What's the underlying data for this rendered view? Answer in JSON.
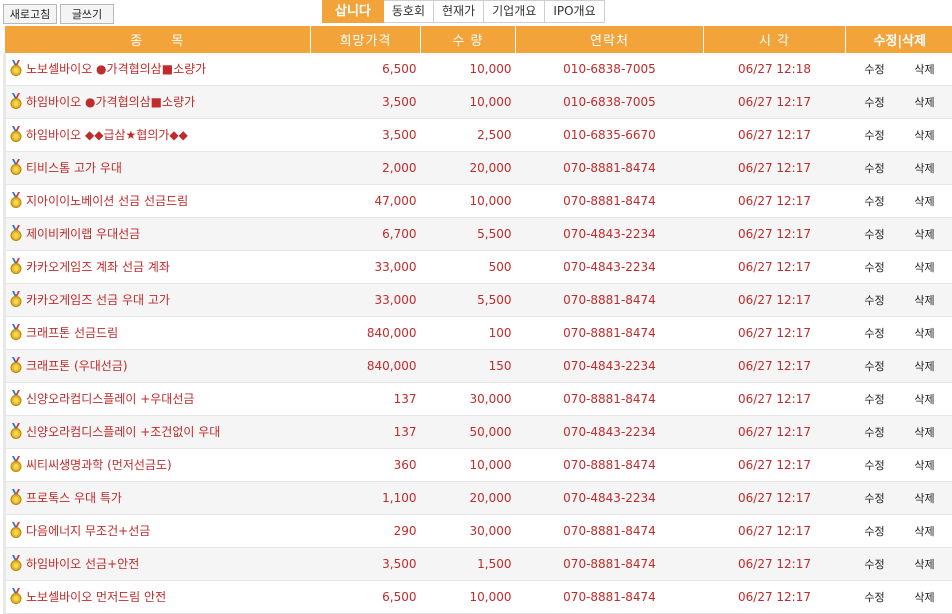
{
  "toolbar": {
    "refresh_label": "새로고침",
    "write_label": "글쓰기"
  },
  "tabs": [
    {
      "label": "삽니다",
      "active": true
    },
    {
      "label": "동호회",
      "active": false
    },
    {
      "label": "현재가",
      "active": false
    },
    {
      "label": "기업개요",
      "active": false
    },
    {
      "label": "IPO개요",
      "active": false
    }
  ],
  "table": {
    "headers": {
      "item": "종　　목",
      "price": "희망가격",
      "qty": "수 량",
      "contact": "연락처",
      "time": "시 각",
      "actions": "수정|삭제"
    },
    "edit_label": "수정",
    "delete_label": "삭제",
    "rows": [
      {
        "name": "노보셀바이오 ●가격협의삼■소량가",
        "price": "6,500",
        "qty": "10,000",
        "contact": "010-6838-7005",
        "time": "06/27 12:18"
      },
      {
        "name": "하임바이오 ●가격협의삼■소량가",
        "price": "3,500",
        "qty": "10,000",
        "contact": "010-6838-7005",
        "time": "06/27 12:17"
      },
      {
        "name": "하임바이오 ◆◆급삼★협의가◆◆",
        "price": "3,500",
        "qty": "2,500",
        "contact": "010-6835-6670",
        "time": "06/27 12:17"
      },
      {
        "name": "티비스톰 고가 우대",
        "price": "2,000",
        "qty": "20,000",
        "contact": "070-8881-8474",
        "time": "06/27 12:17"
      },
      {
        "name": "지아이이노베이션 선금 선금드림",
        "price": "47,000",
        "qty": "10,000",
        "contact": "070-8881-8474",
        "time": "06/27 12:17"
      },
      {
        "name": "제이비케이랩 우대선금",
        "price": "6,700",
        "qty": "5,500",
        "contact": "070-4843-2234",
        "time": "06/27 12:17"
      },
      {
        "name": "카카오게임즈 계좌 선금 계좌",
        "price": "33,000",
        "qty": "500",
        "contact": "070-4843-2234",
        "time": "06/27 12:17"
      },
      {
        "name": "카카오게임즈 선금 우대 고가",
        "price": "33,000",
        "qty": "5,500",
        "contact": "070-8881-8474",
        "time": "06/27 12:17"
      },
      {
        "name": "크래프톤 선금드림",
        "price": "840,000",
        "qty": "100",
        "contact": "070-8881-8474",
        "time": "06/27 12:17"
      },
      {
        "name": "크래프톤 (우대선금)",
        "price": "840,000",
        "qty": "150",
        "contact": "070-4843-2234",
        "time": "06/27 12:17"
      },
      {
        "name": "신양오라컴디스플레이 +우대선금",
        "price": "137",
        "qty": "30,000",
        "contact": "070-8881-8474",
        "time": "06/27 12:17"
      },
      {
        "name": "신양오라컴디스플레이 +조건없이 우대",
        "price": "137",
        "qty": "50,000",
        "contact": "070-4843-2234",
        "time": "06/27 12:17"
      },
      {
        "name": "씨티씨생명과학 (먼저선금도)",
        "price": "360",
        "qty": "10,000",
        "contact": "070-8881-8474",
        "time": "06/27 12:17"
      },
      {
        "name": "프로톡스 우대 특가",
        "price": "1,100",
        "qty": "20,000",
        "contact": "070-4843-2234",
        "time": "06/27 12:17"
      },
      {
        "name": "다음에너지 무조건+선금",
        "price": "290",
        "qty": "30,000",
        "contact": "070-8881-8474",
        "time": "06/27 12:17"
      },
      {
        "name": "하임바이오 선금+안전",
        "price": "3,500",
        "qty": "1,500",
        "contact": "070-8881-8474",
        "time": "06/27 12:17"
      },
      {
        "name": "노보셀바이오 먼저드림 안전",
        "price": "6,500",
        "qty": "10,000",
        "contact": "070-8881-8474",
        "time": "06/27 12:17"
      }
    ]
  },
  "icons": {
    "row_icon": "medal-icon"
  },
  "colors": {
    "accent": "#f2a33a",
    "text_red": "#c02b2b",
    "row_alt": "#f5f5f5"
  }
}
